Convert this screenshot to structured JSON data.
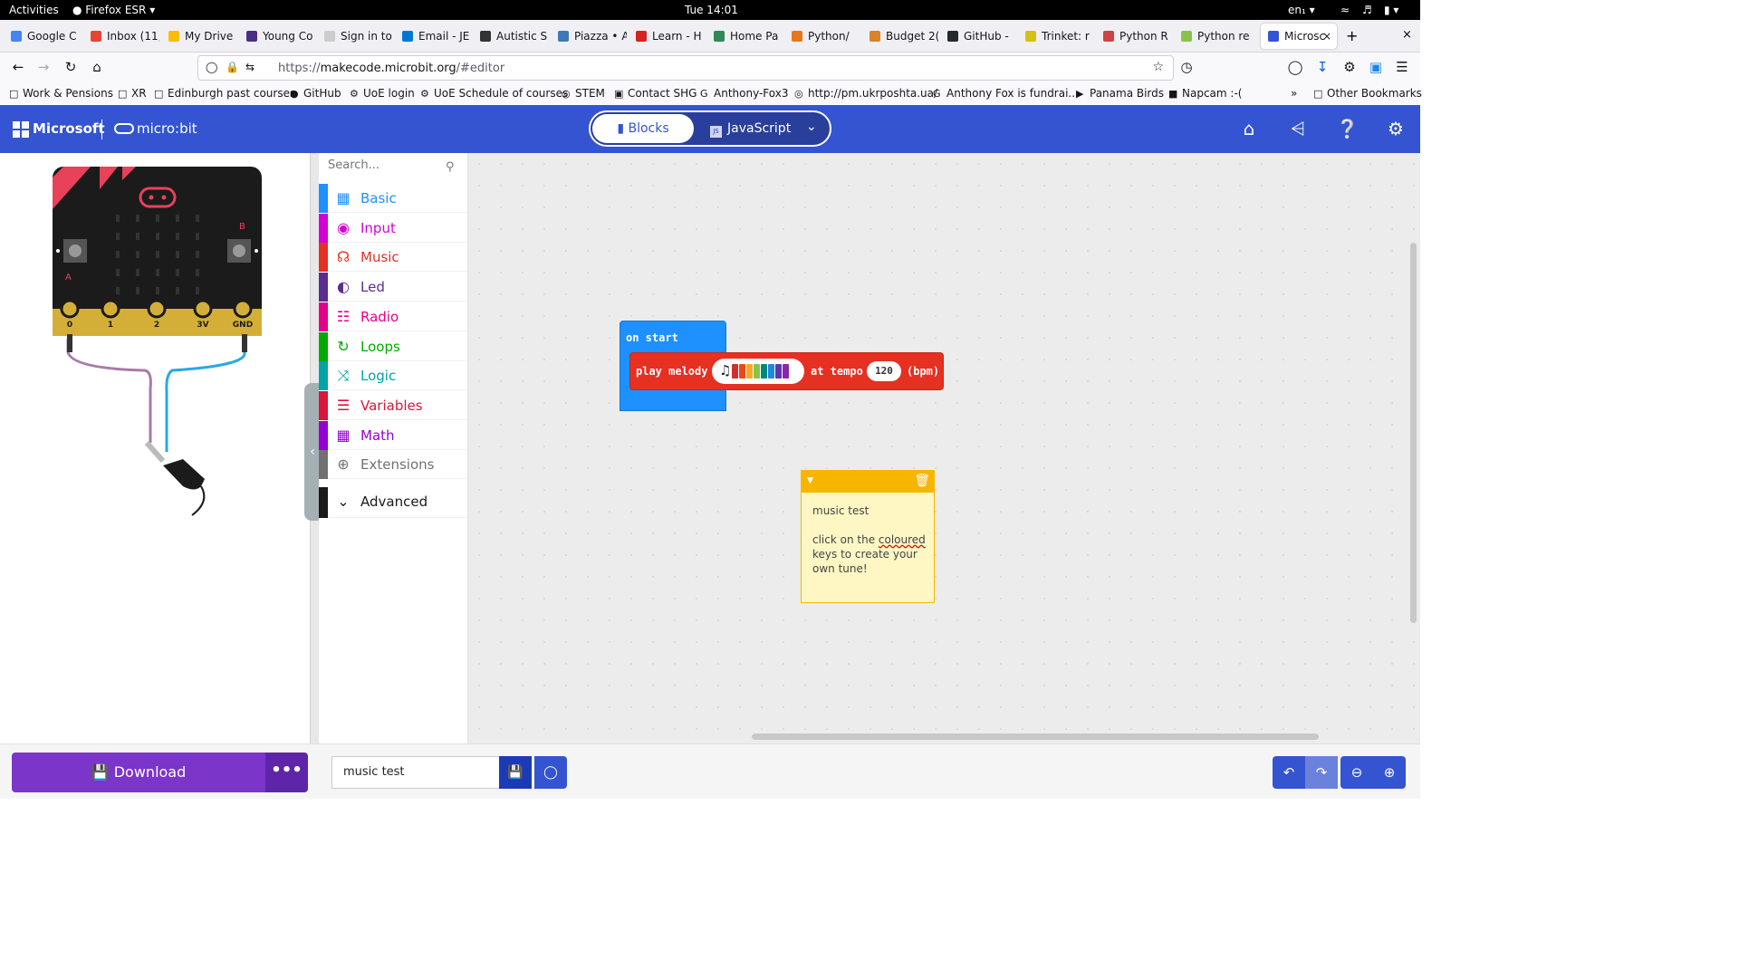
{
  "gnome": {
    "activities": "Activities",
    "app": "Firefox ESR",
    "clock": "Tue 14:01",
    "lang": "en₁"
  },
  "tabs": [
    {
      "label": "Google C",
      "color": "#4285f4"
    },
    {
      "label": "Inbox (11,",
      "color": "#ea4335"
    },
    {
      "label": "My Drive",
      "color": "#fbbc04"
    },
    {
      "label": "Young Co",
      "color": "#4b2e83"
    },
    {
      "label": "Sign in to",
      "color": "#cccccc"
    },
    {
      "label": "Email - JE",
      "color": "#0078d4"
    },
    {
      "label": "Autistic S",
      "color": "#333333"
    },
    {
      "label": "Piazza • A",
      "color": "#3e7ab7"
    },
    {
      "label": "Learn - H",
      "color": "#d6231f"
    },
    {
      "label": "Home Pa",
      "color": "#2e8b57"
    },
    {
      "label": "Python/",
      "color": "#e8761b"
    },
    {
      "label": "Budget 2(",
      "color": "#d9822b"
    },
    {
      "label": "GitHub -",
      "color": "#24292e"
    },
    {
      "label": "Trinket: r",
      "color": "#d4c20f"
    },
    {
      "label": "Python R",
      "color": "#c44"
    },
    {
      "label": "Python re",
      "color": "#8bc34a"
    },
    {
      "label": "Microsc",
      "color": "#3454d1"
    }
  ],
  "nav": {
    "url_prefix": "https://",
    "url_host": "makecode.microbit.org",
    "url_path": "/#editor"
  },
  "bookmarks": [
    "Work & Pensions",
    "XR",
    "Edinburgh past courses",
    "GitHub",
    "UoE login",
    "UoE Schedule of courses",
    "STEM",
    "Contact SHG",
    "Anthony-Fox3",
    "http://pm.ukrposhta.ua/",
    "Anthony Fox is fundrai...",
    "Panama Birds",
    "Napcam :-(",
    "Other Bookmarks"
  ],
  "header": {
    "microsoft": "Microsoft",
    "microbit": "micro:bit",
    "blocks": "Blocks",
    "javascript": "JavaScript",
    "js_badge": "JS"
  },
  "simulator": {
    "pins": [
      "0",
      "1",
      "2",
      "3V",
      "GND"
    ],
    "button_a": "A",
    "button_b": "B"
  },
  "toolbox": {
    "search_placeholder": "Search...",
    "categories": [
      {
        "label": "Basic",
        "color": "#1e90ff"
      },
      {
        "label": "Input",
        "color": "#d400d4"
      },
      {
        "label": "Music",
        "color": "#e63022"
      },
      {
        "label": "Led",
        "color": "#5c2d91"
      },
      {
        "label": "Radio",
        "color": "#e3008c"
      },
      {
        "label": "Loops",
        "color": "#00aa00"
      },
      {
        "label": "Logic",
        "color": "#00a4a6"
      },
      {
        "label": "Variables",
        "color": "#dc143c"
      },
      {
        "label": "Math",
        "color": "#9400d3"
      },
      {
        "label": "Extensions",
        "color": "#717171"
      },
      {
        "label": "Advanced",
        "color": "#1a1a1a"
      }
    ]
  },
  "workspace": {
    "on_start": "on start",
    "play_melody": "play melody",
    "at_tempo": "at tempo",
    "tempo_value": "120",
    "bpm": "(bpm)",
    "melody_colors": [
      "#d32f2f",
      "#e64a19",
      "#f9a825",
      "#8bc34a",
      "#00897b",
      "#1e88e5",
      "#5e35b1",
      "#8e24aa"
    ],
    "comment_title": "music test",
    "comment_line_pre": "click on the ",
    "comment_word": "coloured",
    "comment_line_post": " keys to create your own tune!"
  },
  "bottom": {
    "download": "Download",
    "more": "•••",
    "project_name": "music test"
  }
}
